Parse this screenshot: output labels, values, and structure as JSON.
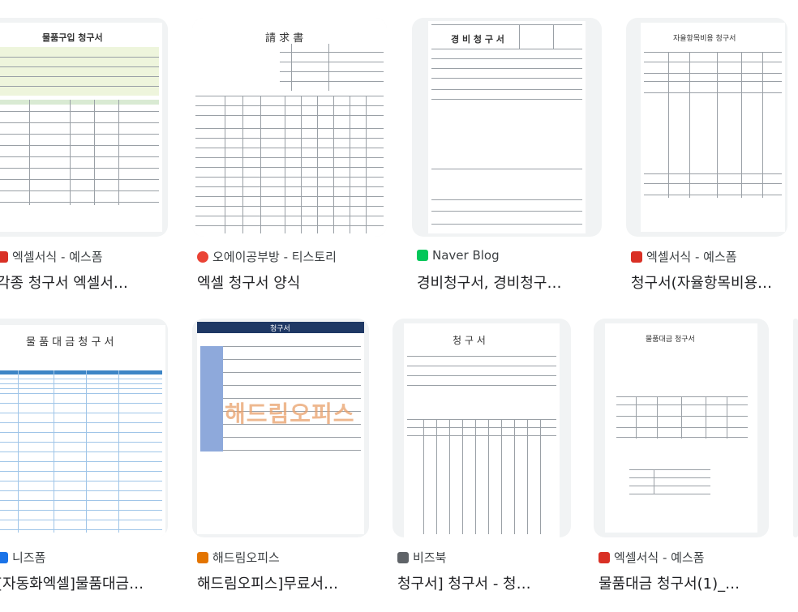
{
  "results": [
    {
      "source": "엑셀서식 - 예스폼",
      "title": "각종 청구서 엑셀서…",
      "doc_title": "물품구입 청구서",
      "icon": "yesform-icon",
      "icon_color": "#d93025"
    },
    {
      "source": "오에이공부방 - 티스토리",
      "title": "엑셀 청구서 양식",
      "doc_title": "請 求 書",
      "icon": "tistory-icon",
      "icon_color": "#ea4335"
    },
    {
      "source": "Naver Blog",
      "title": "경비청구서, 경비청구…",
      "doc_title": "경 비 청 구 서",
      "icon": "naver-blog-icon",
      "icon_color": "#03c75a"
    },
    {
      "source": "엑셀서식 - 예스폼",
      "title": "청구서(자율항목비용…",
      "doc_title": "자율항목비용 청구서",
      "icon": "yesform-icon",
      "icon_color": "#d93025"
    },
    {
      "source": "니즈폼",
      "title": "[자동화엑셀]물품대금…",
      "doc_title": "물 품 대 금 청 구 서",
      "icon": "needsform-icon",
      "icon_color": "#1a73e8"
    },
    {
      "source": "해드림오피스",
      "title": "해드림오피스]무료서…",
      "doc_title": "청구서",
      "watermark": "해드림오피스",
      "icon": "hdream-icon",
      "icon_color": "#e37400"
    },
    {
      "source": "비즈북",
      "title": "청구서] 청구서 - 청…",
      "doc_title": "청   구   서",
      "icon": "bizbook-icon",
      "icon_color": "#5f6368"
    },
    {
      "source": "엑셀서식 - 예스폼",
      "title": "물품대금 청구서(1)_…",
      "doc_title": "물품대금 청구서",
      "icon": "yesform-icon",
      "icon_color": "#d93025"
    }
  ]
}
